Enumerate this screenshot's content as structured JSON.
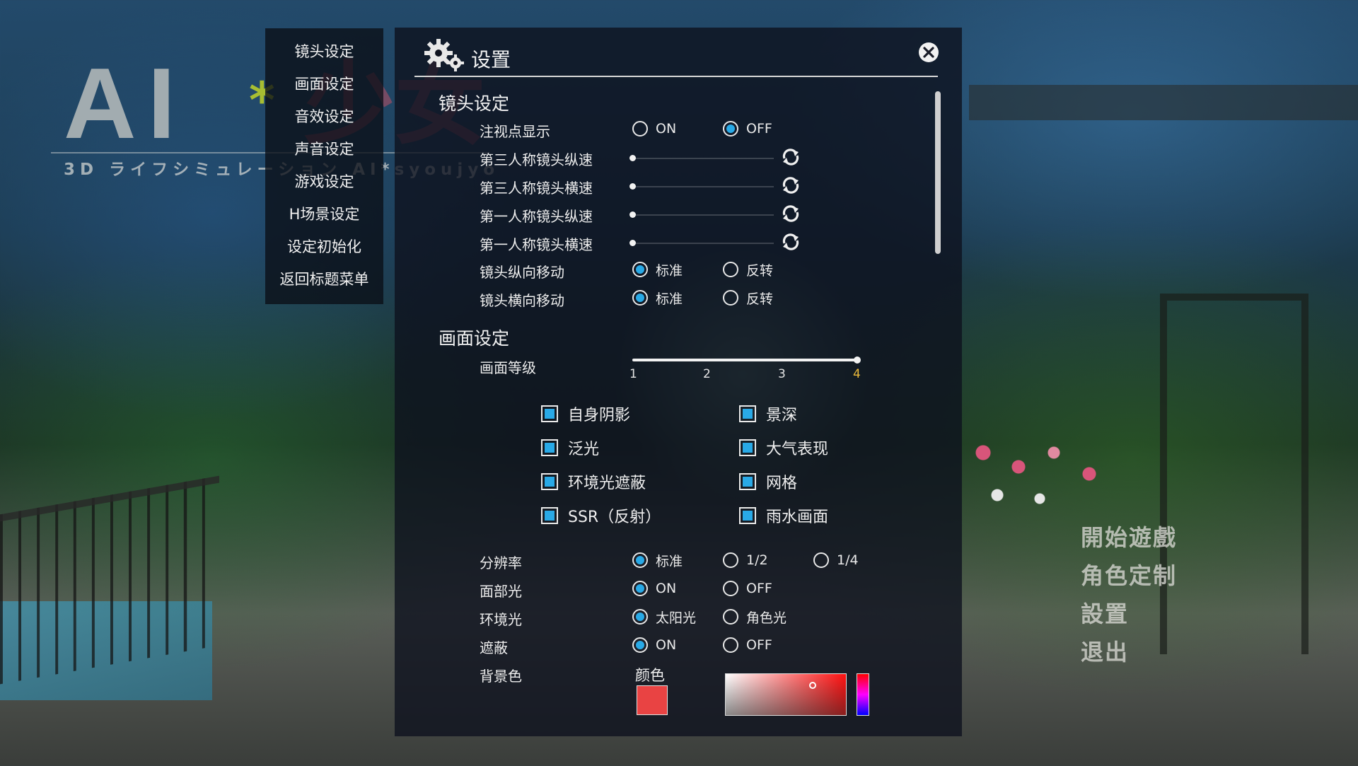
{
  "logo": {
    "main": "AI",
    "star": "*",
    "kanji": "少女",
    "subtitle": "3D ライフシミュレーション AI*syoujyo"
  },
  "side_menu": {
    "items": [
      {
        "label": "镜头设定"
      },
      {
        "label": "画面设定"
      },
      {
        "label": "音效设定"
      },
      {
        "label": "声音设定"
      },
      {
        "label": "游戏设定"
      },
      {
        "label": "H场景设定"
      },
      {
        "label": "设定初始化"
      },
      {
        "label": "返回标题菜单"
      }
    ]
  },
  "panel": {
    "title": "设置",
    "camera": {
      "section_title": "镜头设定",
      "focus_point": {
        "label": "注视点显示",
        "on": "ON",
        "off": "OFF",
        "selected": "OFF"
      },
      "sliders": [
        {
          "label": "第三人称镜头纵速",
          "value": 0
        },
        {
          "label": "第三人称镜头横速",
          "value": 0
        },
        {
          "label": "第一人称镜头纵速",
          "value": 0
        },
        {
          "label": "第一人称镜头横速",
          "value": 0
        }
      ],
      "vertical_move": {
        "label": "镜头纵向移动",
        "standard": "标准",
        "reverse": "反转",
        "selected": "标准"
      },
      "horizontal_move": {
        "label": "镜头横向移动",
        "standard": "标准",
        "reverse": "反转",
        "selected": "标准"
      }
    },
    "graphics": {
      "section_title": "画面设定",
      "quality": {
        "label": "画面等级",
        "ticks": [
          "1",
          "2",
          "3",
          "4"
        ],
        "value": 4
      },
      "checkboxes": [
        {
          "label": "自身阴影",
          "checked": true
        },
        {
          "label": "景深",
          "checked": true
        },
        {
          "label": "泛光",
          "checked": true
        },
        {
          "label": "大气表现",
          "checked": true
        },
        {
          "label": "环境光遮蔽",
          "checked": true
        },
        {
          "label": "网格",
          "checked": true
        },
        {
          "label": "SSR（反射）",
          "checked": true
        },
        {
          "label": "雨水画面",
          "checked": true
        }
      ],
      "resolution": {
        "label": "分辨率",
        "options": [
          "标准",
          "1/2",
          "1/4"
        ],
        "selected": "标准"
      },
      "face_light": {
        "label": "面部光",
        "options": [
          "ON",
          "OFF"
        ],
        "selected": "ON"
      },
      "ambient_light": {
        "label": "环境光",
        "options": [
          "太阳光",
          "角色光"
        ],
        "selected": "太阳光"
      },
      "occlusion": {
        "label": "遮蔽",
        "options": [
          "ON",
          "OFF"
        ],
        "selected": "ON"
      },
      "background_color": {
        "label": "背景色",
        "color_label": "颜色",
        "value": "#e94343"
      }
    }
  },
  "main_menu": {
    "items": [
      {
        "label": "開始遊戲"
      },
      {
        "label": "角色定制"
      },
      {
        "label": "設置"
      },
      {
        "label": "退出"
      }
    ]
  },
  "colors": {
    "accent": "#29a9e6",
    "panel_bg": "#0e121e",
    "tick_active": "#e8b83a"
  },
  "icons": [
    "gear-icon",
    "close-icon",
    "reset-icon",
    "radio-icon",
    "checkbox-icon"
  ]
}
